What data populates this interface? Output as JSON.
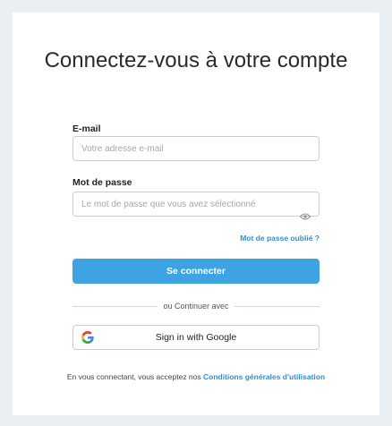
{
  "page": {
    "title": "Connectez-vous à votre compte"
  },
  "form": {
    "email_label": "E-mail",
    "email_placeholder": "Votre adresse e-mail",
    "email_value": "",
    "password_label": "Mot de passe",
    "password_placeholder": "Le mot de passe que vous avez sélectionné",
    "password_value": "",
    "toggle_visibility_icon": "eye-icon",
    "forgot_label": "Mot de passe oublié ?",
    "submit_label": "Se connecter"
  },
  "divider": {
    "text": "ou Continuer avec"
  },
  "google": {
    "icon": "google-logo-icon",
    "label": "Sign in with Google"
  },
  "terms": {
    "prefix": "En vous connectant, vous acceptez nos ",
    "link_label": "Conditions générales d'utilisation"
  },
  "colors": {
    "background": "#e9eff3",
    "card": "#ffffff",
    "primary": "#3ea3e2",
    "link": "#2f8fd3"
  }
}
